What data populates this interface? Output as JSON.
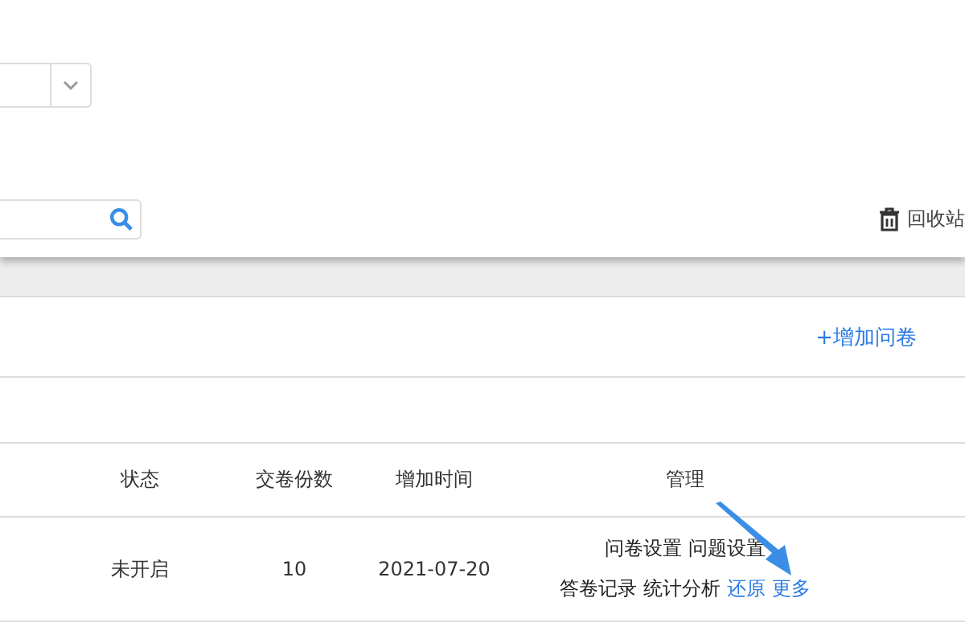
{
  "recycle_bin": {
    "label": "回收站"
  },
  "toolbar": {
    "add_button": "+增加问卷"
  },
  "table": {
    "columns": [
      "状态",
      "交卷份数",
      "增加时间",
      "管理"
    ],
    "rows": [
      {
        "status": "未开启",
        "count": "10",
        "date": "2021-07-20",
        "action_lines": [
          [
            {
              "label": "问卷设置",
              "kind": "plain"
            },
            {
              "label": "问题设置",
              "kind": "plain"
            }
          ],
          [
            {
              "label": "答卷记录",
              "kind": "plain"
            },
            {
              "label": "统计分析",
              "kind": "plain"
            },
            {
              "label": "还原",
              "kind": "link"
            },
            {
              "label": "更多",
              "kind": "link"
            }
          ]
        ]
      }
    ]
  }
}
